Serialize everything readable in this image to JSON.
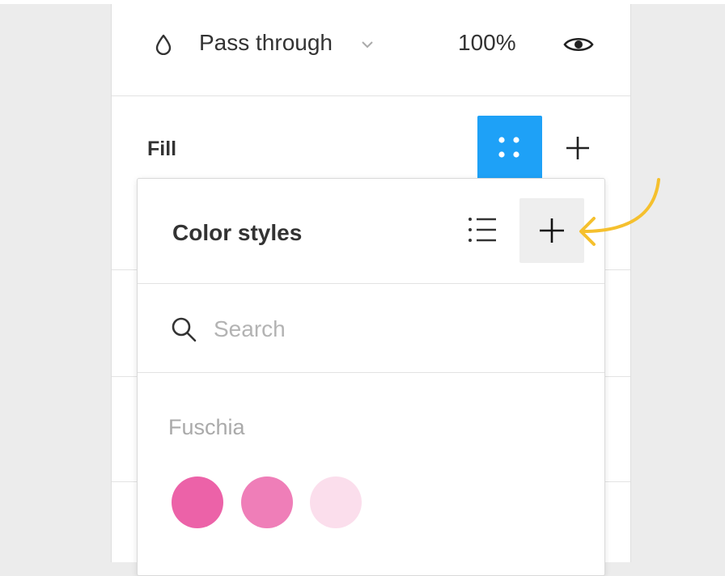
{
  "layer": {
    "blend_mode": "Pass through",
    "opacity": "100%",
    "icons": {
      "blend": "drop-icon",
      "dropdown": "chevron-down-icon",
      "visibility": "eye-icon"
    }
  },
  "fill": {
    "title": "Fill",
    "icons": {
      "styles": "four-dots-icon",
      "add": "plus-icon"
    }
  },
  "color_styles_popover": {
    "title": "Color styles",
    "icons": {
      "list_view": "list-icon",
      "create_style": "plus-icon",
      "search": "search-icon"
    },
    "search": {
      "placeholder": "Search",
      "value": ""
    },
    "groups": [
      {
        "name": "Fuschia",
        "swatches": [
          {
            "color": "#ec62a8"
          },
          {
            "color": "#ef7eb8"
          },
          {
            "color": "#fbdeec"
          }
        ]
      }
    ]
  },
  "colors": {
    "accent_blue": "#1ea1f7",
    "annotation_arrow": "#f5c02e"
  }
}
